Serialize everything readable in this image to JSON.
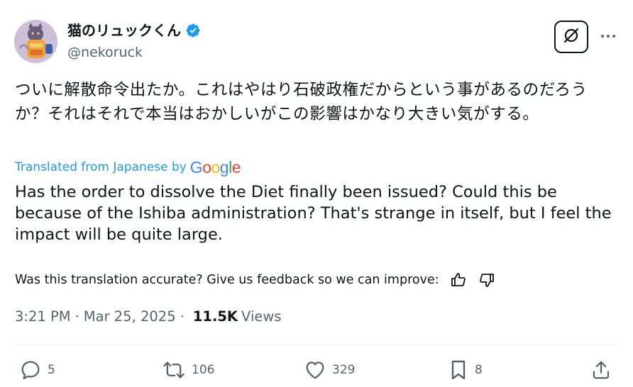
{
  "author": {
    "display_name": "猫のリュックくん",
    "handle": "@nekoruck",
    "verified": true
  },
  "post": {
    "original_text": "ついに解散命令出たか。これはやはり石破政権だからという事があるのだろうか？それはそれで本当はおかしいがこの影響はかなり大きい気がする。",
    "translated_label": "Translated from Japanese by",
    "translation_provider": "Google",
    "translated_text": "Has the order to dissolve the Diet finally been issued? Could this be because of the Ishiba administration? That's strange in itself, but I feel the impact will be quite large.",
    "feedback_prompt": "Was this translation accurate? Give us feedback so we can improve:",
    "time": "3:21 PM",
    "date": "Mar 25, 2025",
    "views_count": "11.5K",
    "views_label": "Views"
  },
  "actions": {
    "replies": "5",
    "reposts": "106",
    "likes": "329",
    "bookmarks": "8"
  },
  "colors": {
    "link_blue": "#1d9bf0",
    "text_primary": "#0f1419",
    "text_secondary": "#536471",
    "verified": "#1d9bf0"
  },
  "icons": {
    "grok": "grok-slash-icon",
    "more": "more-dots-icon",
    "thumbs_up": "thumbs-up-icon",
    "thumbs_down": "thumbs-down-icon",
    "reply": "reply-bubble-icon",
    "repost": "repost-arrows-icon",
    "like": "heart-icon",
    "bookmark": "bookmark-icon",
    "share": "share-upload-icon"
  }
}
